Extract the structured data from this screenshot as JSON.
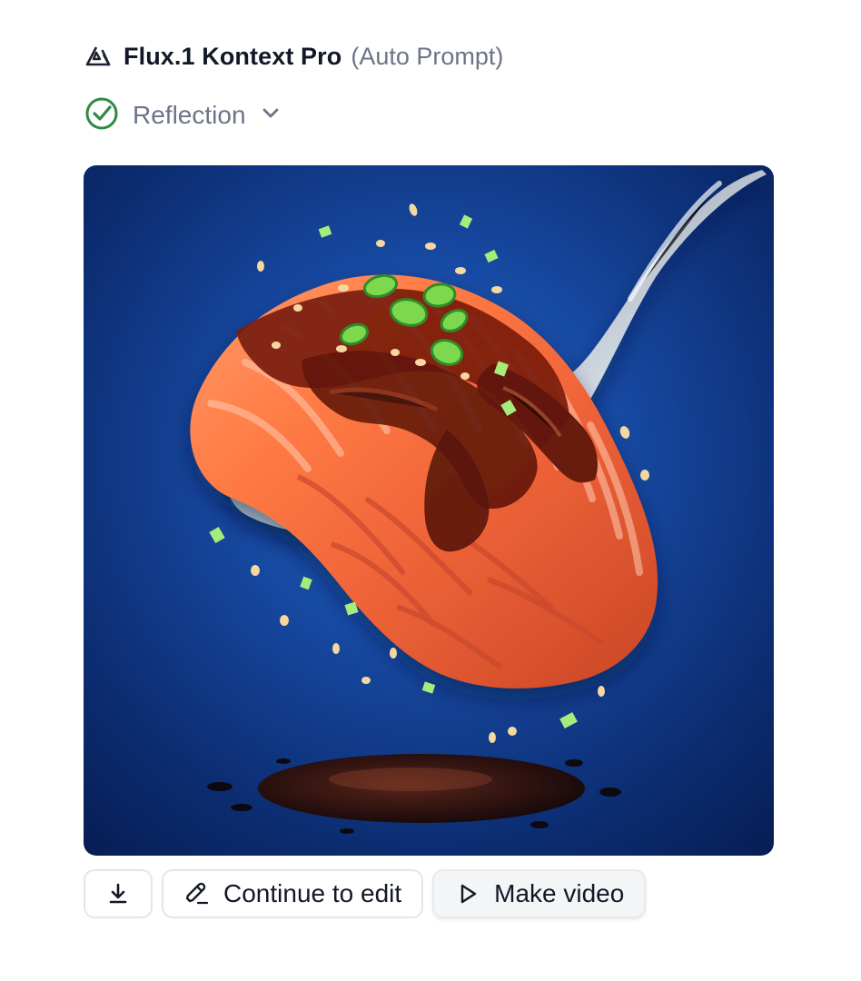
{
  "header": {
    "model_name": "Flux.1 Kontext Pro",
    "model_subtitle": "(Auto Prompt)",
    "model_icon": "triangle-logo-icon"
  },
  "status": {
    "label": "Reflection",
    "icon": "check-circle-icon",
    "dropdown_icon": "chevron-down-icon",
    "status_color": "#2f8a43"
  },
  "image": {
    "alt": "A glazed salmon fillet on a spoon with sesame seeds and green onions over a blue background"
  },
  "actions": {
    "download_icon": "download-icon",
    "continue_label": "Continue to edit",
    "continue_icon": "pencil-icon",
    "video_label": "Make video",
    "video_icon": "play-icon"
  }
}
